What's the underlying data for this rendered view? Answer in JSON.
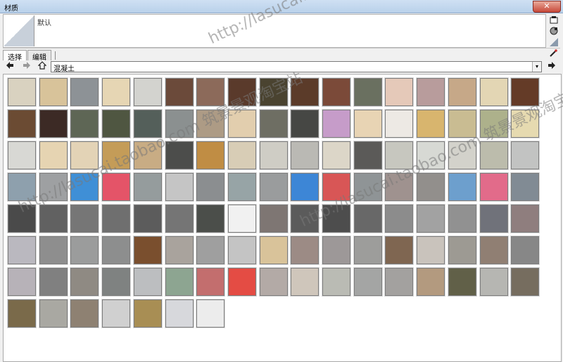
{
  "window": {
    "title": "材质",
    "close_label": "✕"
  },
  "preview": {
    "material_name": "默认"
  },
  "tabs": [
    "选择",
    "编辑"
  ],
  "library": {
    "current": "混凝土",
    "dropdown_arrow": "▾"
  },
  "watermark_text": "http://lasucai.taobao.com 筑景景观淘宝站",
  "swatches": [
    [
      "#d9d2c0",
      "#d8c39a",
      "#8d9296",
      "#e6d6b4",
      "#d3d3cf",
      "#6b4a3a",
      "#8c6a5a",
      "#5a3a2b",
      "#4a4330",
      "#5b3b29",
      "#7b4a39",
      "#6a7060",
      "#e5c9b9",
      "#b89c9c",
      "#c6a888",
      "#e3d6b4",
      "#643b27"
    ],
    [
      "#6b4b33",
      "#3c2a25",
      "#5e6655",
      "#4f5641",
      "#545f5a",
      "#8b9090",
      "#ad9b85",
      "#e2ceae",
      "#6e6e63",
      "#464744",
      "#c69cc9",
      "#e8d4b4",
      "#ede9e4",
      "#d8b56e",
      "#c9bc92",
      "#adb18b",
      "#e6dab0"
    ],
    [
      "#d8d8d4",
      "#e6d4b2",
      "#e3d3b6",
      "#c49c58",
      "#c8ac84",
      "#4c4d4b",
      "#c08d44",
      "#d8cdb6",
      "#cfcdc5",
      "#bab9b4",
      "#dcd6c8",
      "#5b5a58",
      "#c7c7bf",
      "#d7d9d4",
      "#d3d2cb",
      "#bcbcac",
      "#c2c3c2"
    ],
    [
      "#8ea0ad",
      "#9ea0a2",
      "#3f8fd6",
      "#e45468",
      "#959c9d",
      "#c5c5c5",
      "#8b8e90",
      "#97a4a6",
      "#9a9c9d",
      "#3d86d6",
      "#d85656",
      "#8f9496",
      "#9f928f",
      "#928f8c",
      "#6d9fcd",
      "#e26b8a",
      "#818b94"
    ],
    [
      "#4a4a4a",
      "#616161",
      "#767676",
      "#6f6f6f",
      "#5c5c5c",
      "#757575",
      "#4b4e4a",
      "#f1f1f1",
      "#7e7673",
      "#5b5b5b",
      "#4d4d4d",
      "#686868",
      "#8c8c8c",
      "#a2a2a2",
      "#919191",
      "#70727a",
      "#8f7e7e"
    ],
    [
      "#bab8bf",
      "#8e8e8e",
      "#9b9c9c",
      "#8d8e8e",
      "#7a4f2e",
      "#a9a39d",
      "#9f9f9f",
      "#c4c4c4",
      "#d9c39a",
      "#9c8b85",
      "#9d9898",
      "#9d9d9b",
      "#7f6651",
      "#c9c3bc",
      "#9d9a93",
      "#907f73",
      "#878787"
    ],
    [
      "#b7b2b8",
      "#808080",
      "#8f8a83",
      "#7f8281",
      "#bcbec0",
      "#8da591",
      "#c36e6e",
      "#e44c44",
      "#b3aaa6",
      "#cfc6bb",
      "#babbb4",
      "#a4a5a4",
      "#a3a19f",
      "#b39a7f",
      "#616048",
      "#b6b6b2",
      "#766d5f"
    ],
    [
      "#7a6a4a",
      "#a9a8a2",
      "#8e8172",
      "#d0d0d0",
      "#a88e54",
      "#d7d8dc",
      "#ececec"
    ]
  ]
}
